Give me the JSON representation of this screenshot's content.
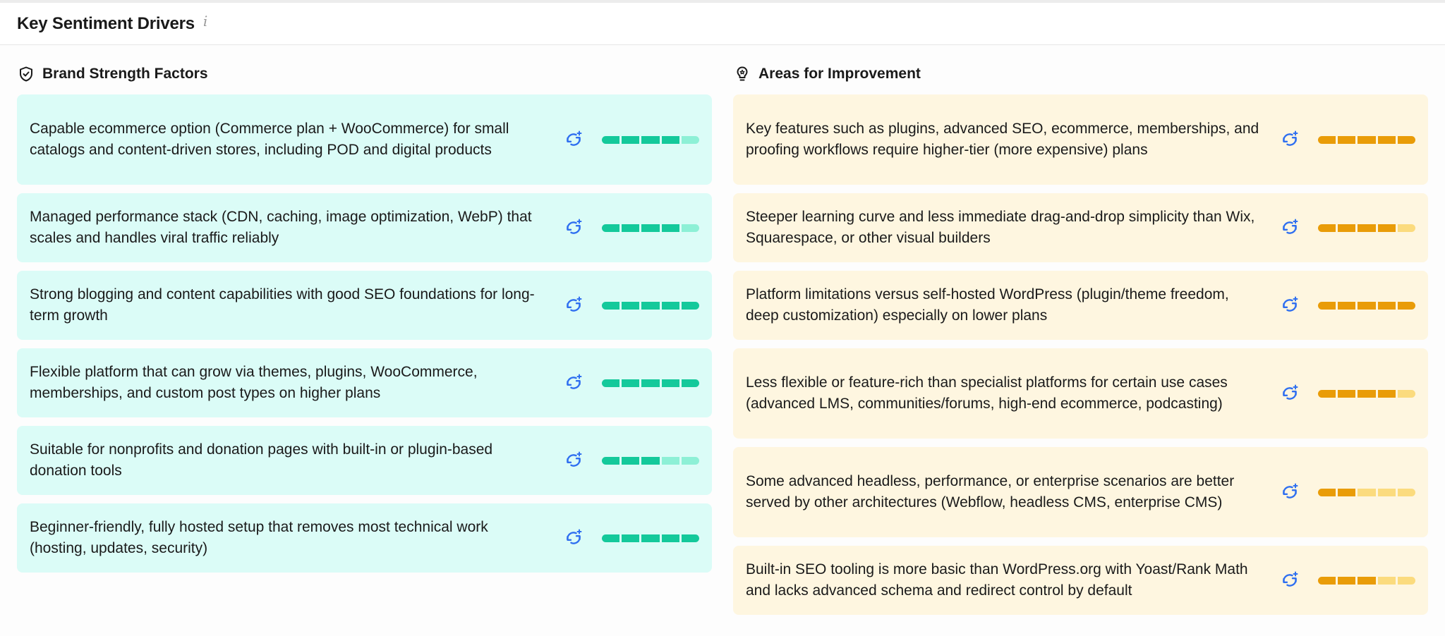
{
  "header": {
    "title": "Key Sentiment Drivers",
    "info_glyph": "i"
  },
  "strengths": {
    "title": "Brand Strength Factors",
    "icon": "shield-check-icon",
    "color_on": "#14c99b",
    "color_off": "#8df0d6",
    "items": [
      {
        "text": "Capable ecommerce option (Commerce plan + WooCommerce) for small catalogs and content-driven stores, including POD and digital products",
        "score": 4
      },
      {
        "text": "Managed performance stack (CDN, caching, image optimization, WebP) that scales and handles viral traffic reliably",
        "score": 4
      },
      {
        "text": "Strong blogging and content capabilities with good SEO foundations for long-term growth",
        "score": 5
      },
      {
        "text": "Flexible platform that can grow via themes, plugins, WooCommerce, memberships, and custom post types on higher plans",
        "score": 5
      },
      {
        "text": "Suitable for nonprofits and donation pages with built-in or plugin-based donation tools",
        "score": 3
      },
      {
        "text": "Beginner-friendly, fully hosted setup that removes most technical work (hosting, updates, security)",
        "score": 5
      }
    ]
  },
  "improvements": {
    "title": "Areas for Improvement",
    "icon": "lightbulb-icon",
    "color_on": "#e99c08",
    "color_off": "#fbdb7e",
    "items": [
      {
        "text": "Key features such as plugins, advanced SEO, ecommerce, memberships, and proofing workflows require higher-tier (more expensive) plans",
        "score": 5
      },
      {
        "text": "Steeper learning curve and less immediate drag-and-drop simplicity than Wix, Squarespace, or other visual builders",
        "score": 4
      },
      {
        "text": "Platform limitations versus self-hosted WordPress (plugin/theme freedom, deep customization) especially on lower plans",
        "score": 5
      },
      {
        "text": "Less flexible or feature-rich than specialist platforms for certain use cases (advanced LMS, communities/forums, high-end ecommerce, podcasting)",
        "score": 4
      },
      {
        "text": "Some advanced headless, performance, or enterprise scenarios are better served by other architectures (Webflow, headless CMS, enterprise CMS)",
        "score": 2
      },
      {
        "text": "Built-in SEO tooling is more basic than WordPress.org with Yoast/Rank Math and lacks advanced schema and redirect control by default",
        "score": 3
      }
    ],
    "segments": 5
  }
}
